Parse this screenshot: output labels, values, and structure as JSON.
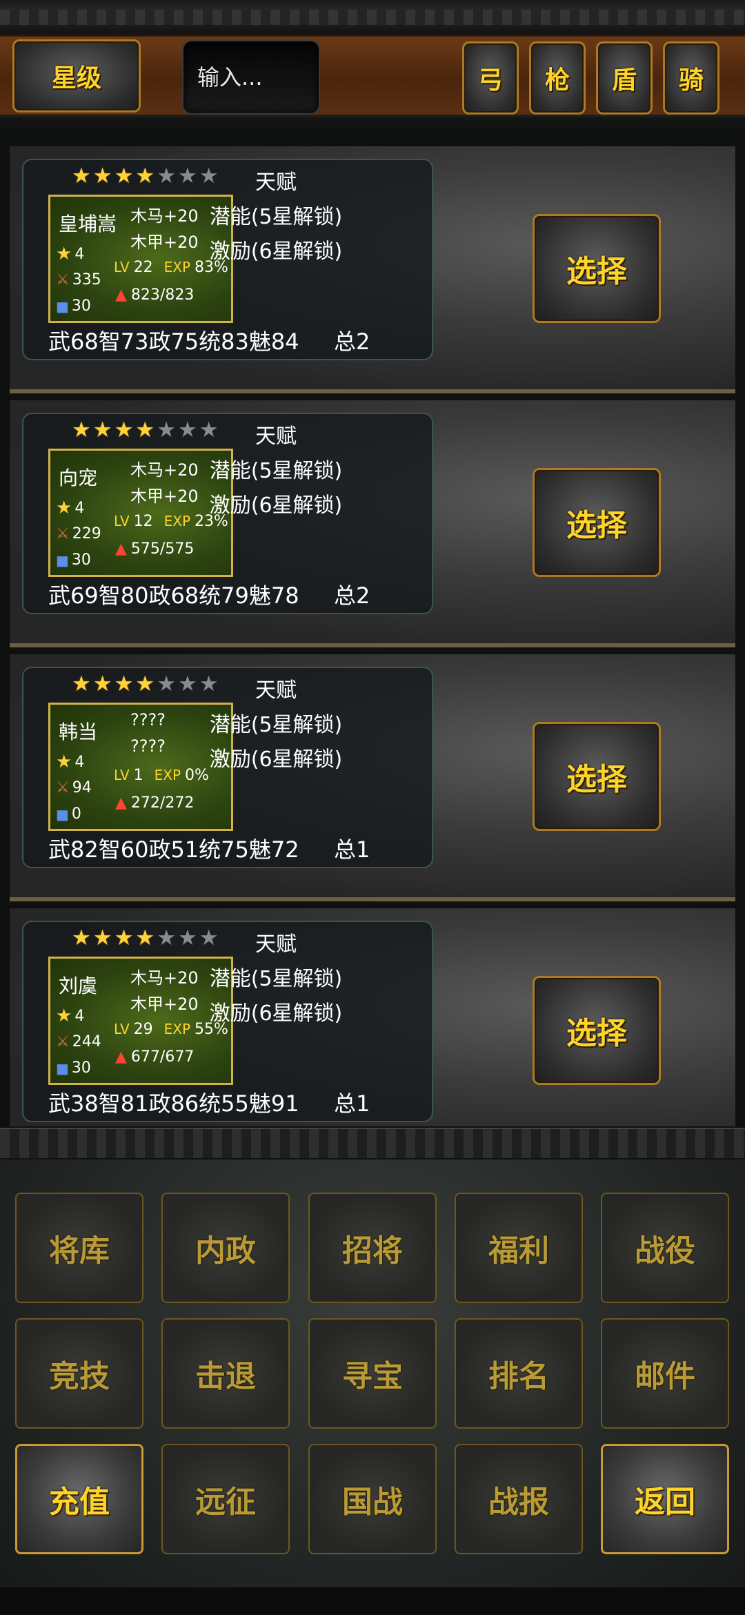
{
  "toolbar": {
    "star_button": "星级",
    "search_placeholder": "输入...",
    "types": [
      "弓",
      "枪",
      "盾",
      "骑"
    ]
  },
  "generals": [
    {
      "stars_filled": 4,
      "stars_total": 7,
      "name": "皇埔嵩",
      "star_level": "4",
      "attack": "335",
      "defense": "30",
      "bonus1": "木马+20",
      "bonus2": "木甲+20",
      "lv_label": "LV",
      "lv": "22",
      "exp_label": "EXP",
      "exp": "83%",
      "hp": "823/823",
      "talent_title": "天赋",
      "talent_line1": "潜能(5星解锁)",
      "talent_line2": "激励(6星解锁)",
      "attrs": "武68智73政75统83魅84",
      "total": "总2",
      "select_label": "选择"
    },
    {
      "stars_filled": 4,
      "stars_total": 7,
      "name": "向宠",
      "star_level": "4",
      "attack": "229",
      "defense": "30",
      "bonus1": "木马+20",
      "bonus2": "木甲+20",
      "lv_label": "LV",
      "lv": "12",
      "exp_label": "EXP",
      "exp": "23%",
      "hp": "575/575",
      "talent_title": "天赋",
      "talent_line1": "潜能(5星解锁)",
      "talent_line2": "激励(6星解锁)",
      "attrs": "武69智80政68统79魅78",
      "total": "总2",
      "select_label": "选择"
    },
    {
      "stars_filled": 4,
      "stars_total": 7,
      "name": "韩当",
      "star_level": "4",
      "attack": "94",
      "defense": "0",
      "bonus1": "????",
      "bonus2": "????",
      "lv_label": "LV",
      "lv": "1",
      "exp_label": "EXP",
      "exp": "0%",
      "hp": "272/272",
      "talent_title": "天赋",
      "talent_line1": "潜能(5星解锁)",
      "talent_line2": "激励(6星解锁)",
      "attrs": "武82智60政51统75魅72",
      "total": "总1",
      "select_label": "选择"
    },
    {
      "stars_filled": 4,
      "stars_total": 7,
      "name": "刘虞",
      "star_level": "4",
      "attack": "244",
      "defense": "30",
      "bonus1": "木马+20",
      "bonus2": "木甲+20",
      "lv_label": "LV",
      "lv": "29",
      "exp_label": "EXP",
      "exp": "55%",
      "hp": "677/677",
      "talent_title": "天赋",
      "talent_line1": "潜能(5星解锁)",
      "talent_line2": "激励(6星解锁)",
      "attrs": "武38智81政86统55魅91",
      "total": "总1",
      "select_label": "选择"
    }
  ],
  "menu": {
    "row1": [
      "将库",
      "内政",
      "招将",
      "福利",
      "战役"
    ],
    "row2": [
      "竞技",
      "击退",
      "寻宝",
      "排名",
      "邮件"
    ],
    "row3": [
      "充值",
      "远征",
      "国战",
      "战报",
      "返回"
    ]
  }
}
